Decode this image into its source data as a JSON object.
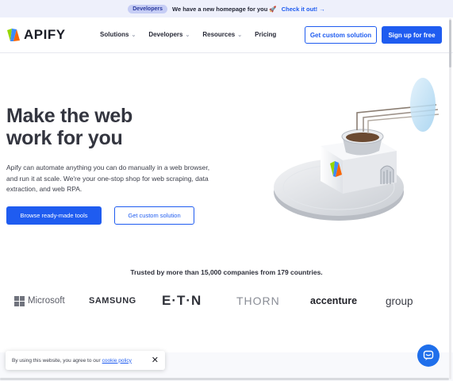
{
  "announcement": {
    "badge": "Developers",
    "message": "We have a new homepage for you 🚀",
    "link": "Check it out! →"
  },
  "header": {
    "logo_text": "APIFY",
    "nav": [
      {
        "label": "Solutions",
        "has_dropdown": true
      },
      {
        "label": "Developers",
        "has_dropdown": true
      },
      {
        "label": "Resources",
        "has_dropdown": true
      },
      {
        "label": "Pricing",
        "has_dropdown": false
      }
    ],
    "cta_outline": "Get custom solution",
    "cta_primary": "Sign up for free"
  },
  "hero": {
    "title_line1": "Make the web",
    "title_line2": "work for you",
    "description": "Apify can automate anything you can do manually in a web browser, and run it at scale. We're your one-stop shop for web scraping, data extraction, and web RPA.",
    "btn_primary": "Browse ready-made tools",
    "btn_outline": "Get custom solution"
  },
  "trusted": {
    "text": "Trusted by more than 15,000 companies from 179 countries.",
    "companies": [
      "Microsoft",
      "SAMSUNG",
      "E·T·N",
      "THORN",
      "accenture",
      "group"
    ]
  },
  "cookie": {
    "text": "By using this website, you agree to our",
    "link": "cookie policy",
    "close": "✕"
  },
  "colors": {
    "primary": "#1f5cf0",
    "announce_bg": "#eef0fb",
    "text_dark": "#33353f"
  }
}
